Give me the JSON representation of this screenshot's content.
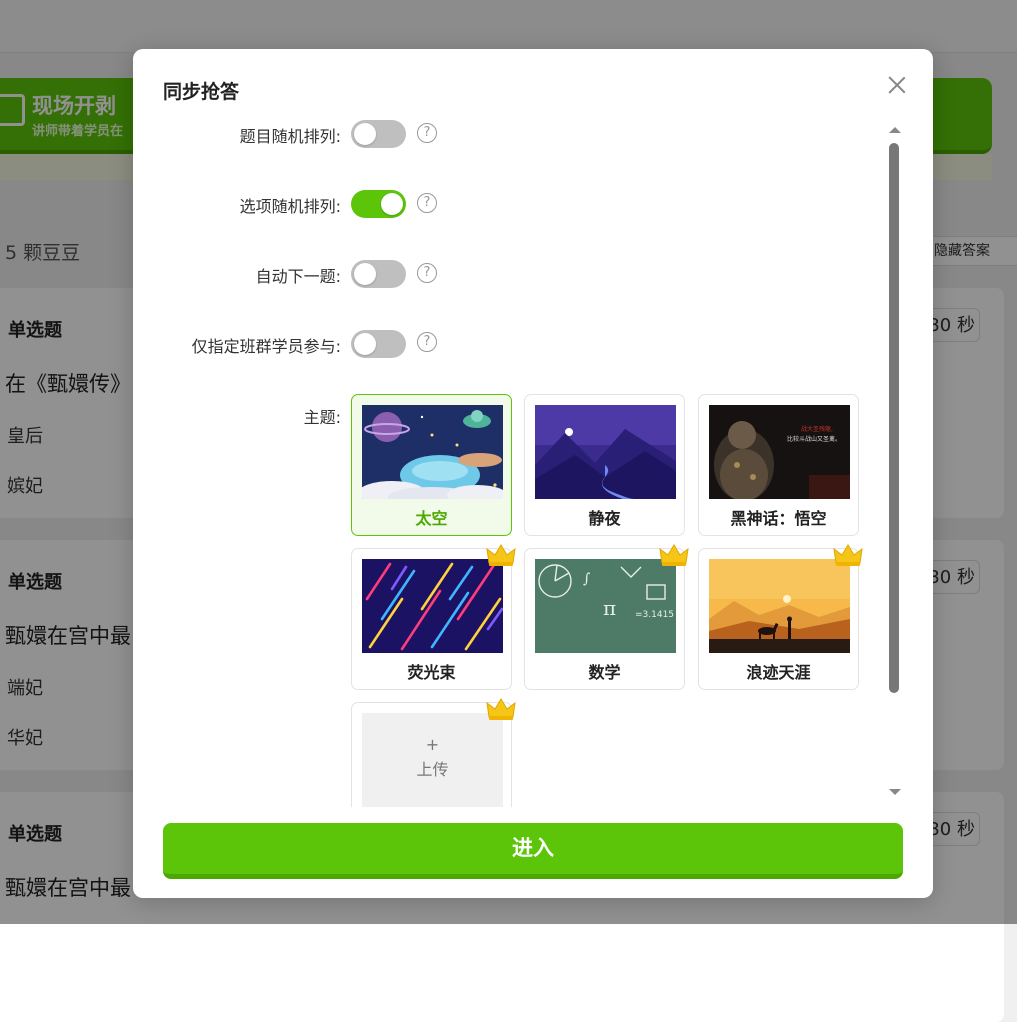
{
  "background": {
    "banner": {
      "title": "现场开剥",
      "subtitle": "讲师带着学员在"
    },
    "beans_label": "5 颗豆豆",
    "hide_answer_label": "隐藏答案",
    "questions": [
      {
        "type": "单选题",
        "text": "在《甄嬛传》",
        "options": [
          "皇后",
          "嫔妃"
        ],
        "timer": "30 秒"
      },
      {
        "type": "单选题",
        "text": "甄嬛在宫中最",
        "options": [
          "端妃",
          "华妃"
        ],
        "timer": "30 秒"
      },
      {
        "type": "单选题",
        "text": "甄嬛在宫中最",
        "options": [],
        "timer": "30 秒"
      }
    ]
  },
  "modal": {
    "title": "同步抢答",
    "settings": [
      {
        "label": "题目随机排列:",
        "on": false
      },
      {
        "label": "选项随机排列:",
        "on": true
      },
      {
        "label": "自动下一题:",
        "on": false
      },
      {
        "label": "仅指定班群学员参与:",
        "on": false
      }
    ],
    "theme_label": "主题:",
    "themes": [
      {
        "name": "太空",
        "selected": true,
        "premium": false,
        "thumb": "space"
      },
      {
        "name": "静夜",
        "selected": false,
        "premium": false,
        "thumb": "night"
      },
      {
        "name": "黑神话：悟空",
        "selected": false,
        "premium": false,
        "thumb": "wukong",
        "thumb_text": [
          "战大圣残躯,",
          "比较斗战山又圣禽。"
        ]
      },
      {
        "name": "荧光束",
        "selected": false,
        "premium": true,
        "thumb": "neon"
      },
      {
        "name": "数学",
        "selected": false,
        "premium": true,
        "thumb": "math",
        "thumb_text": [
          "∫",
          "π",
          "=3.1415"
        ]
      },
      {
        "name": "浪迹天涯",
        "selected": false,
        "premium": true,
        "thumb": "desert"
      }
    ],
    "upload": {
      "plus": "+",
      "label": "上传",
      "premium": true
    },
    "enter_label": "进入"
  },
  "colors": {
    "accent": "#5cc50a",
    "accent_dark": "#4aa800",
    "crown": "#f5c518"
  },
  "icons": [
    "close-icon",
    "help-icon",
    "crown-icon",
    "scroll-up-arrow",
    "scroll-down-arrow"
  ]
}
